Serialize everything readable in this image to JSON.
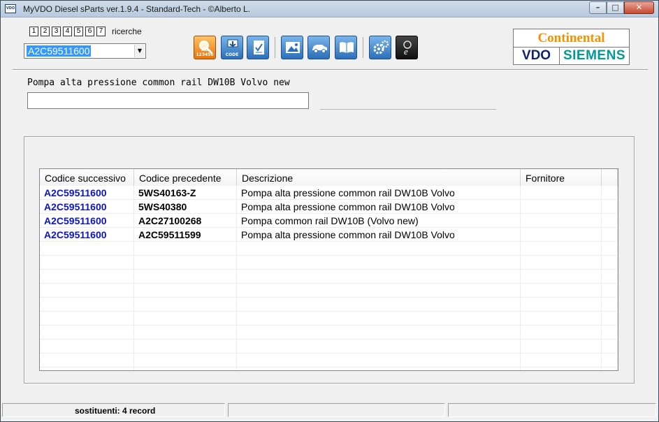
{
  "window": {
    "title": "MyVDO Diesel sParts  ver.1.9.4  -  Standard-Tech  -   ©Alberto L.",
    "app_icon_text": "VDO",
    "minimize": "–",
    "maximize": "□",
    "close": "✕"
  },
  "search": {
    "history_buttons": [
      "1",
      "2",
      "3",
      "4",
      "5",
      "6",
      "7"
    ],
    "history_label": "ricerche",
    "code_value": "A2C59511600",
    "dropdown_arrow": "▼"
  },
  "toolbar": {
    "buttons": [
      {
        "name": "search-code-button",
        "icon": "magnifier-icon",
        "label": "AB 123456"
      },
      {
        "name": "code-button",
        "icon": "download-code-icon",
        "label": "CODE"
      },
      {
        "name": "checklist-button",
        "icon": "checklist-icon",
        "label": ""
      },
      {
        "name": "image-button",
        "icon": "picture-icon",
        "label": ""
      },
      {
        "name": "vehicle-button",
        "icon": "car-icon",
        "label": ""
      },
      {
        "name": "manual-button",
        "icon": "book-icon",
        "label": ""
      },
      {
        "name": "settings-button",
        "icon": "gears-icon",
        "label": ""
      },
      {
        "name": "web-button",
        "icon": "internet-explorer-icon",
        "label": ""
      }
    ]
  },
  "logo": {
    "top": "Continental",
    "left": "VDO",
    "right": "SIEMENS"
  },
  "product": {
    "description": "Pompa alta pressione common rail DW10B Volvo new",
    "input_value": ""
  },
  "grid": {
    "columns": [
      "Codice successivo",
      "Codice precedente",
      "Descrizione",
      "Fornitore",
      ""
    ],
    "rows": [
      {
        "next": "A2C59511600",
        "prev": "5WS40163-Z",
        "desc": "Pompa alta pressione common rail DW10B Volvo",
        "supplier": ""
      },
      {
        "next": "A2C59511600",
        "prev": "5WS40380",
        "desc": "Pompa alta pressione common rail DW10B Volvo",
        "supplier": ""
      },
      {
        "next": "A2C59511600",
        "prev": "A2C27100268",
        "desc": "Pompa common rail DW10B (Volvo new)",
        "supplier": ""
      },
      {
        "next": "A2C59511600",
        "prev": "A2C59511599",
        "desc": "Pompa alta pressione common rail DW10B Volvo",
        "supplier": ""
      }
    ]
  },
  "status": {
    "records": "sostituenti: 4 record",
    "panel2": "",
    "panel3": ""
  },
  "colors": {
    "accent_blue": "#0a14c8",
    "selection": "#3399ff",
    "continental_orange": "#f39200",
    "vdo_navy": "#10226b",
    "siemens_teal": "#009999"
  }
}
